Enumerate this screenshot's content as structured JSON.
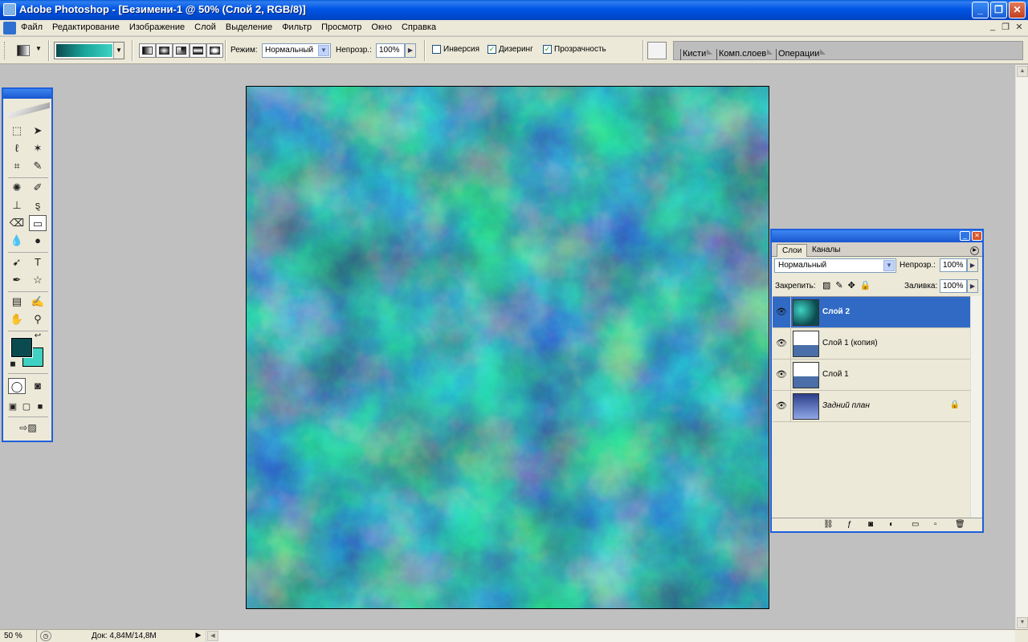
{
  "window": {
    "title": "Adobe Photoshop - [Безимени-1 @ 50% (Слой 2, RGB/8)]",
    "minimize_label": "_",
    "maximize_label": "❐",
    "close_label": "✕"
  },
  "menu": {
    "items": [
      "Файл",
      "Редактирование",
      "Изображение",
      "Слой",
      "Выделение",
      "Фильтр",
      "Просмотр",
      "Окно",
      "Справка"
    ]
  },
  "options": {
    "mode_label": "Режим:",
    "mode_value": "Нормальный",
    "opacity_label": "Непрозр.:",
    "opacity_value": "100%",
    "reverse_label": "Инверсия",
    "reverse_checked": false,
    "dither_label": "Дизеринг",
    "dither_checked": true,
    "transparency_label": "Прозрачность",
    "transparency_checked": true,
    "gradient_colors": [
      "#0b4a4e",
      "#3fd2c3"
    ]
  },
  "palette_well": {
    "tabs": [
      "Кисти",
      "Комп.слоев",
      "Операции"
    ]
  },
  "toolbox": {
    "foreground_color": "#0b4a4e",
    "background_color": "#3fd2c3",
    "active_tool": "gradient-tool"
  },
  "layers_panel": {
    "tabs": [
      "Слои",
      "Каналы"
    ],
    "active_tab": "Слои",
    "blend_mode": "Нормальный",
    "opacity_label": "Непрозр.:",
    "opacity_value": "100%",
    "lock_label": "Закрепить:",
    "fill_label": "Заливка:",
    "fill_value": "100%",
    "layers": [
      {
        "name": "Слой 2",
        "selected": true,
        "visible": true,
        "locked": false
      },
      {
        "name": "Слой 1 (копия)",
        "selected": false,
        "visible": true,
        "locked": false
      },
      {
        "name": "Слой 1",
        "selected": false,
        "visible": true,
        "locked": false
      },
      {
        "name": "Задний план",
        "selected": false,
        "visible": true,
        "locked": true
      }
    ]
  },
  "status": {
    "zoom": "50 %",
    "doc_info": "Док: 4,84M/14,8M"
  }
}
